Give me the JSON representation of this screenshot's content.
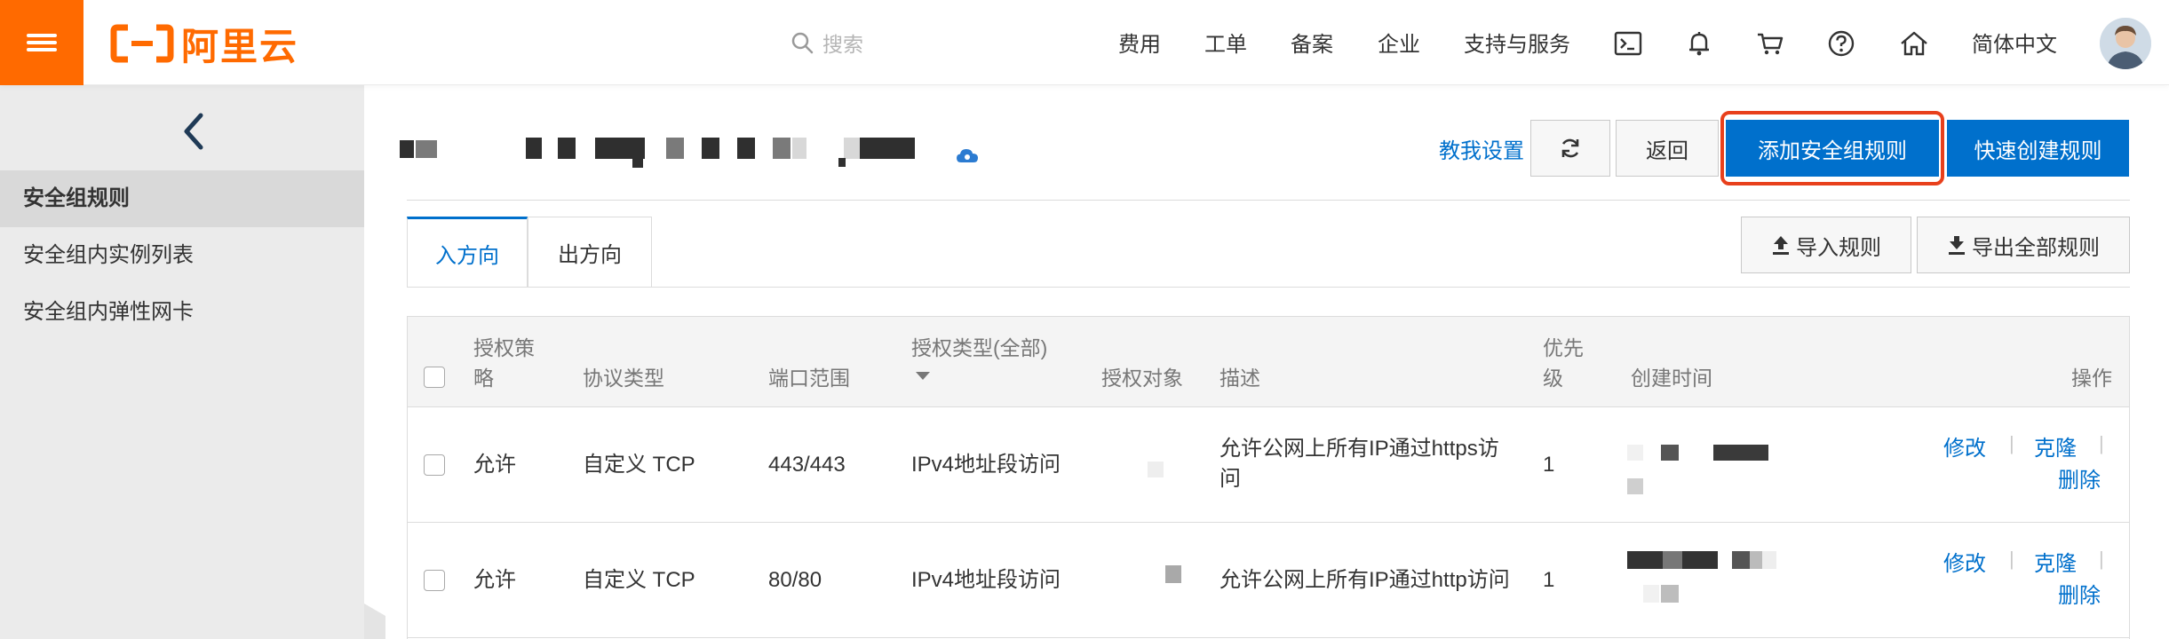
{
  "topbar": {
    "logo_text": "阿里云",
    "search_placeholder": "搜索",
    "nav": [
      "费用",
      "工单",
      "备案",
      "企业",
      "支持与服务"
    ],
    "language": "简体中文",
    "icons": [
      "terminal-icon",
      "bell-icon",
      "cart-icon",
      "help-icon",
      "home-icon"
    ],
    "accent_color": "#ff6a00"
  },
  "sidebar": {
    "items": [
      {
        "label": "安全组规则",
        "active": true
      },
      {
        "label": "安全组内实例列表",
        "active": false
      },
      {
        "label": "安全组内弹性网卡",
        "active": false
      }
    ]
  },
  "header": {
    "teach_link": "教我设置",
    "back_button": "返回",
    "add_rule_button": "添加安全组规则",
    "quick_create_button": "快速创建规则",
    "primary_color": "#0070cc"
  },
  "tabs": [
    {
      "label": "入方向",
      "active": true
    },
    {
      "label": "出方向",
      "active": false
    }
  ],
  "actions": {
    "import": "导入规则",
    "export": "导出全部规则"
  },
  "table": {
    "columns": {
      "policy_line1": "授权策",
      "policy_line2": "略",
      "protocol": "协议类型",
      "port": "端口范围",
      "auth_type": "授权类型(全部)",
      "auth_object": "授权对象",
      "description": "描述",
      "priority_line1": "优先",
      "priority_line2": "级",
      "created": "创建时间",
      "ops": "操作"
    },
    "rows": [
      {
        "policy": "允许",
        "protocol": "自定义 TCP",
        "port": "443/443",
        "auth_type": "IPv4地址段访问",
        "description_line1": "允许公网上所有IP通过https访",
        "description_line2": "问",
        "priority": "1",
        "ops": {
          "edit": "修改",
          "clone": "克隆",
          "delete": "删除"
        }
      },
      {
        "policy": "允许",
        "protocol": "自定义 TCP",
        "port": "80/80",
        "auth_type": "IPv4地址段访问",
        "description_line1": "允许公网上所有IP通过http访问",
        "description_line2": "",
        "priority": "1",
        "ops": {
          "edit": "修改",
          "clone": "克隆",
          "delete": "删除"
        }
      }
    ]
  }
}
